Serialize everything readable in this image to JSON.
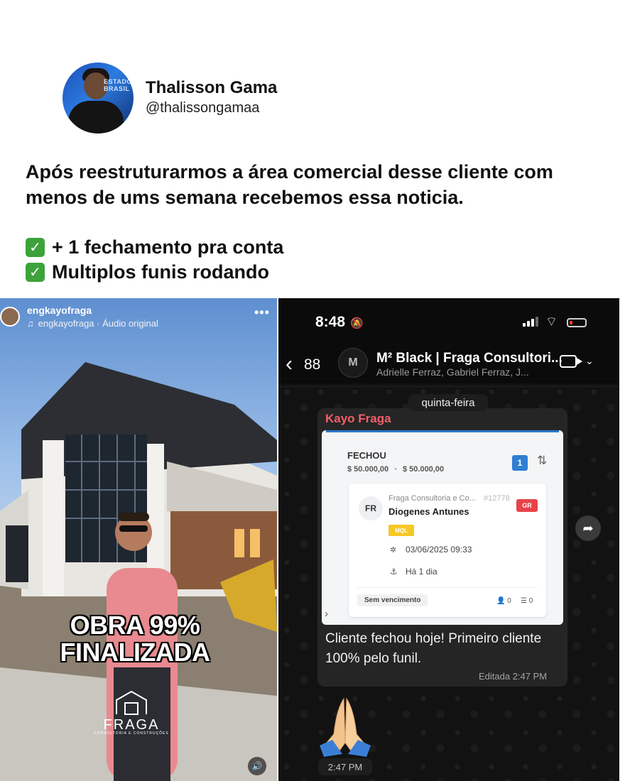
{
  "tweet": {
    "name": "Thalisson Gama",
    "handle": "@thalissongamaa",
    "avatar_sign": "ESTADOS\nBRASIL",
    "text": "Após reestruturarmos a área comercial desse cliente com menos de ums semana recebemos essa noticia.",
    "checks": [
      {
        "icon": "✓",
        "text": "+ 1 fechamento pra conta"
      },
      {
        "icon": "✓",
        "text": "Multiplos funis rodando"
      }
    ]
  },
  "reel": {
    "username": "engkayofraga",
    "audio": "engkayofraga · Áudio original",
    "more": "•••",
    "headline_1": "OBRA 99%",
    "headline_2": "FINALIZADA",
    "logo": "FRAGA",
    "logo_sub": "CONSULTORIA E CONSTRUÇÕES",
    "sound_icon": "🔊"
  },
  "whatsapp": {
    "status_time": "8:48",
    "back_count": "88",
    "group_name": "M² Black | Fraga Consultori...",
    "group_members": "Adrielle Ferraz, Gabriel Ferraz, J...",
    "group_avatar": "M",
    "day": "quinta-feira",
    "sender": "Kayo Fraga",
    "card": {
      "stage": "FECHOU",
      "amount_1": "$ 50.000,00",
      "amount_2": "$ 50.000,00",
      "count": "1",
      "initials": "FR",
      "company": "Fraga Consultoria e Co...",
      "deal_id": "#12778",
      "person": "Diogenes Antunes",
      "tag": "GR",
      "mql": "MQL",
      "date": "03/06/2025 09:33",
      "ago": "Há 1 dia",
      "venc": "Sem vencimento",
      "contacts": "0",
      "tasks": "0"
    },
    "message": "Cliente fechou hoje! Primeiro cliente 100% pelo funil.",
    "message_meta": "Editada  2:47 PM",
    "emoji_time": "2:47 PM"
  },
  "colors": {
    "check_green": "#3ca33a",
    "sender_red": "#f45f6a",
    "badge_blue": "#2f7fd3",
    "tag_red": "#e8434a",
    "mql_yellow": "#f6c826"
  }
}
